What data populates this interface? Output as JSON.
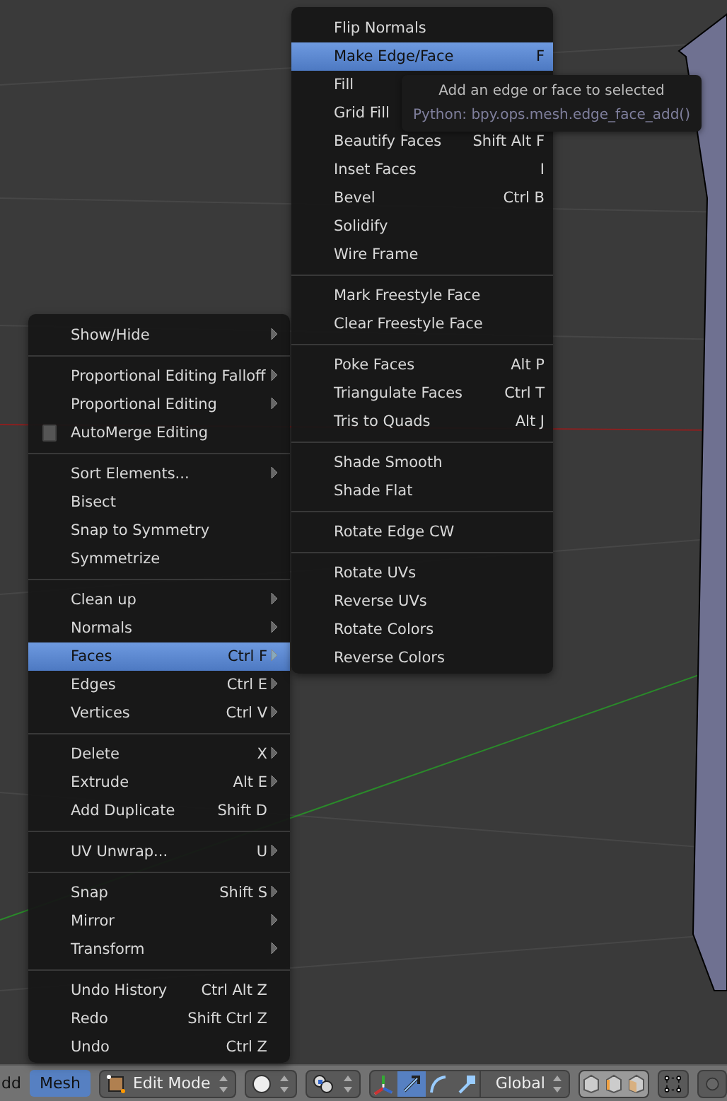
{
  "mesh_menu": {
    "sections": [
      {
        "items": [
          {
            "kind": "submenu",
            "label": "Show/Hide",
            "selected": false
          }
        ]
      },
      {
        "items": [
          {
            "kind": "submenu",
            "label": "Proportional Editing Falloff",
            "selected": false
          },
          {
            "kind": "submenu",
            "label": "Proportional Editing",
            "selected": false
          },
          {
            "kind": "toggle",
            "label": "AutoMerge Editing",
            "selected": false,
            "checked": false
          }
        ]
      },
      {
        "items": [
          {
            "kind": "submenu",
            "label": "Sort Elements...",
            "selected": false
          },
          {
            "kind": "action",
            "label": "Bisect",
            "selected": false
          },
          {
            "kind": "action",
            "label": "Snap to Symmetry",
            "selected": false
          },
          {
            "kind": "action",
            "label": "Symmetrize",
            "selected": false
          }
        ]
      },
      {
        "items": [
          {
            "kind": "submenu",
            "label": "Clean up",
            "selected": false
          },
          {
            "kind": "submenu",
            "label": "Normals",
            "selected": false
          },
          {
            "kind": "submenu",
            "label": "Faces",
            "shortcut": "Ctrl F",
            "selected": true
          },
          {
            "kind": "submenu",
            "label": "Edges",
            "shortcut": "Ctrl E",
            "selected": false
          },
          {
            "kind": "submenu",
            "label": "Vertices",
            "shortcut": "Ctrl V",
            "selected": false
          }
        ]
      },
      {
        "items": [
          {
            "kind": "submenu",
            "label": "Delete",
            "shortcut": "X",
            "selected": false
          },
          {
            "kind": "submenu",
            "label": "Extrude",
            "shortcut": "Alt E",
            "selected": false
          },
          {
            "kind": "action",
            "label": "Add Duplicate",
            "shortcut": "Shift D",
            "selected": false
          }
        ]
      },
      {
        "items": [
          {
            "kind": "submenu",
            "label": "UV Unwrap...",
            "shortcut": "U",
            "selected": false
          }
        ]
      },
      {
        "items": [
          {
            "kind": "submenu",
            "label": "Snap",
            "shortcut": "Shift S",
            "selected": false
          },
          {
            "kind": "submenu",
            "label": "Mirror",
            "selected": false
          },
          {
            "kind": "submenu",
            "label": "Transform",
            "selected": false
          }
        ]
      },
      {
        "items": [
          {
            "kind": "action",
            "label": "Undo History",
            "shortcut": "Ctrl Alt Z",
            "selected": false
          },
          {
            "kind": "action",
            "label": "Redo",
            "shortcut": "Shift Ctrl Z",
            "selected": false
          },
          {
            "kind": "action",
            "label": "Undo",
            "shortcut": "Ctrl Z",
            "selected": false
          }
        ]
      }
    ]
  },
  "faces_menu": {
    "sections": [
      {
        "items": [
          {
            "label": "Flip Normals",
            "selected": false
          },
          {
            "label": "Make Edge/Face",
            "shortcut": "F",
            "selected": true
          },
          {
            "label": "Fill",
            "selected": false
          },
          {
            "label": "Grid Fill",
            "selected": false
          },
          {
            "label": "Beautify Faces",
            "shortcut": "Shift Alt F",
            "selected": false
          },
          {
            "label": "Inset Faces",
            "shortcut": "I",
            "selected": false
          },
          {
            "label": "Bevel",
            "shortcut": "Ctrl B",
            "selected": false
          },
          {
            "label": "Solidify",
            "selected": false
          },
          {
            "label": "Wire Frame",
            "selected": false
          }
        ]
      },
      {
        "items": [
          {
            "label": "Mark Freestyle Face",
            "selected": false
          },
          {
            "label": "Clear Freestyle Face",
            "selected": false
          }
        ]
      },
      {
        "items": [
          {
            "label": "Poke Faces",
            "shortcut": "Alt P",
            "selected": false
          },
          {
            "label": "Triangulate Faces",
            "shortcut": "Ctrl T",
            "selected": false
          },
          {
            "label": "Tris to Quads",
            "shortcut": "Alt J",
            "selected": false
          }
        ]
      },
      {
        "items": [
          {
            "label": "Shade Smooth",
            "selected": false
          },
          {
            "label": "Shade Flat",
            "selected": false
          }
        ]
      },
      {
        "items": [
          {
            "label": "Rotate Edge CW",
            "selected": false
          }
        ]
      },
      {
        "items": [
          {
            "label": "Rotate UVs",
            "selected": false
          },
          {
            "label": "Reverse UVs",
            "selected": false
          },
          {
            "label": "Rotate Colors",
            "selected": false
          },
          {
            "label": "Reverse Colors",
            "selected": false
          }
        ]
      }
    ]
  },
  "tooltip": {
    "description": "Add an edge or face to selected",
    "python": "Python: bpy.ops.mesh.edge_face_add()"
  },
  "header": {
    "cut_label": "dd",
    "menu": {
      "label": "Mesh",
      "selected": true
    },
    "mode": {
      "label": "Edit Mode"
    },
    "manipulators": [
      {
        "kind": "axes",
        "selected": false
      },
      {
        "kind": "translate",
        "selected": true
      },
      {
        "kind": "rotate",
        "selected": false
      },
      {
        "kind": "scale",
        "selected": false
      }
    ],
    "orientation": {
      "label": "Global"
    }
  }
}
